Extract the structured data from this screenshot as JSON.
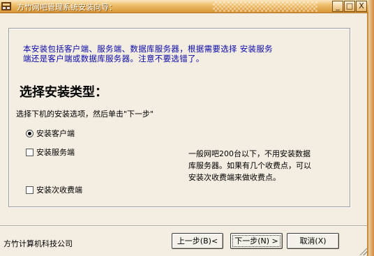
{
  "window": {
    "title": "方竹网吧管理系统安装向导：",
    "controls": {
      "minimize": "_",
      "maximize": "□",
      "close": "X"
    },
    "icon": "app-icon"
  },
  "intro": {
    "line1": "本安装包括客户端、服务端、数据库服务器，根据需要选择 安装服务",
    "line2": "端还是客户端或数据库服务器。注意不要选错了。"
  },
  "heading": "选择安装类型：",
  "instruction": "选择下机的安装选项，然后单击\"下一步\"",
  "options": {
    "client": {
      "label": "安装客户端",
      "selected": true
    },
    "server": {
      "label": "安装服务端",
      "checked": false
    },
    "cashier": {
      "label": "安装次收费端",
      "checked": false
    }
  },
  "note": {
    "line1": "一般网吧200台以下，不用安装数据",
    "line2": "库服务器。如果有几个收费点，可以",
    "line3": "安装次收费端来做收费点。"
  },
  "footer": {
    "company": "方竹计算机科技公司",
    "prev_label": "上一步(B)<",
    "next_label": "下一步(N) >",
    "cancel_label": "取消(X)"
  },
  "colors": {
    "titlebar": "#e8a84a",
    "intro_text": "#0a0aa8",
    "window_bg": "#f3ede2"
  }
}
